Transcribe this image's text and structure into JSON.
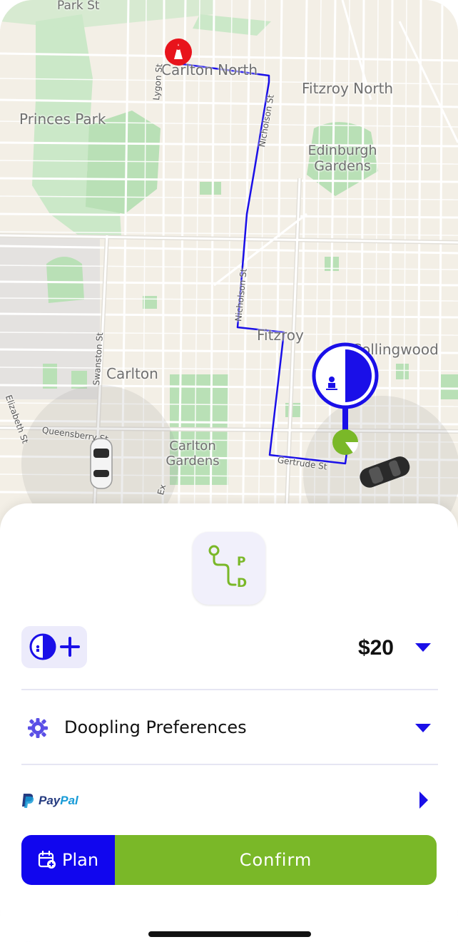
{
  "map": {
    "labels": {
      "park_st": "Park St",
      "carlton_north": "Carlton North",
      "fitzroy_north": "Fitzroy North",
      "princes_park": "Princes Park",
      "edinburgh_gardens": "Edinburgh Gardens",
      "lygon_st": "Lygon St",
      "nicholson_st_top": "Nicholson St",
      "nicholson_st_mid": "Nicholson St",
      "fitzroy": "Fitzroy",
      "collingwood": "Collingwood",
      "swanston_st": "Swanston St",
      "carlton": "Carlton",
      "elizabeth_st": "Elizabeth St",
      "queensberry_st": "Queensberry St",
      "carlton_gardens": "Carlton Gardens",
      "gertrude_st": "Gertrude St",
      "exhibition_st": "Ex"
    },
    "route_color": "#1a0fe8",
    "destination_color": "#e8141c",
    "origin_color": "#7ab828"
  },
  "sheet": {
    "logo_letters": {
      "p": "P",
      "d": "D"
    },
    "price": "$20",
    "preferences_label": "Doopling Preferences",
    "payment": {
      "pay": "Pay",
      "pal": "Pal"
    },
    "plan_label": "Plan",
    "confirm_label": "Confirm"
  },
  "colors": {
    "accent_blue": "#1106ee",
    "accent_green": "#7ab828",
    "chip_bg": "#ecebfb"
  }
}
